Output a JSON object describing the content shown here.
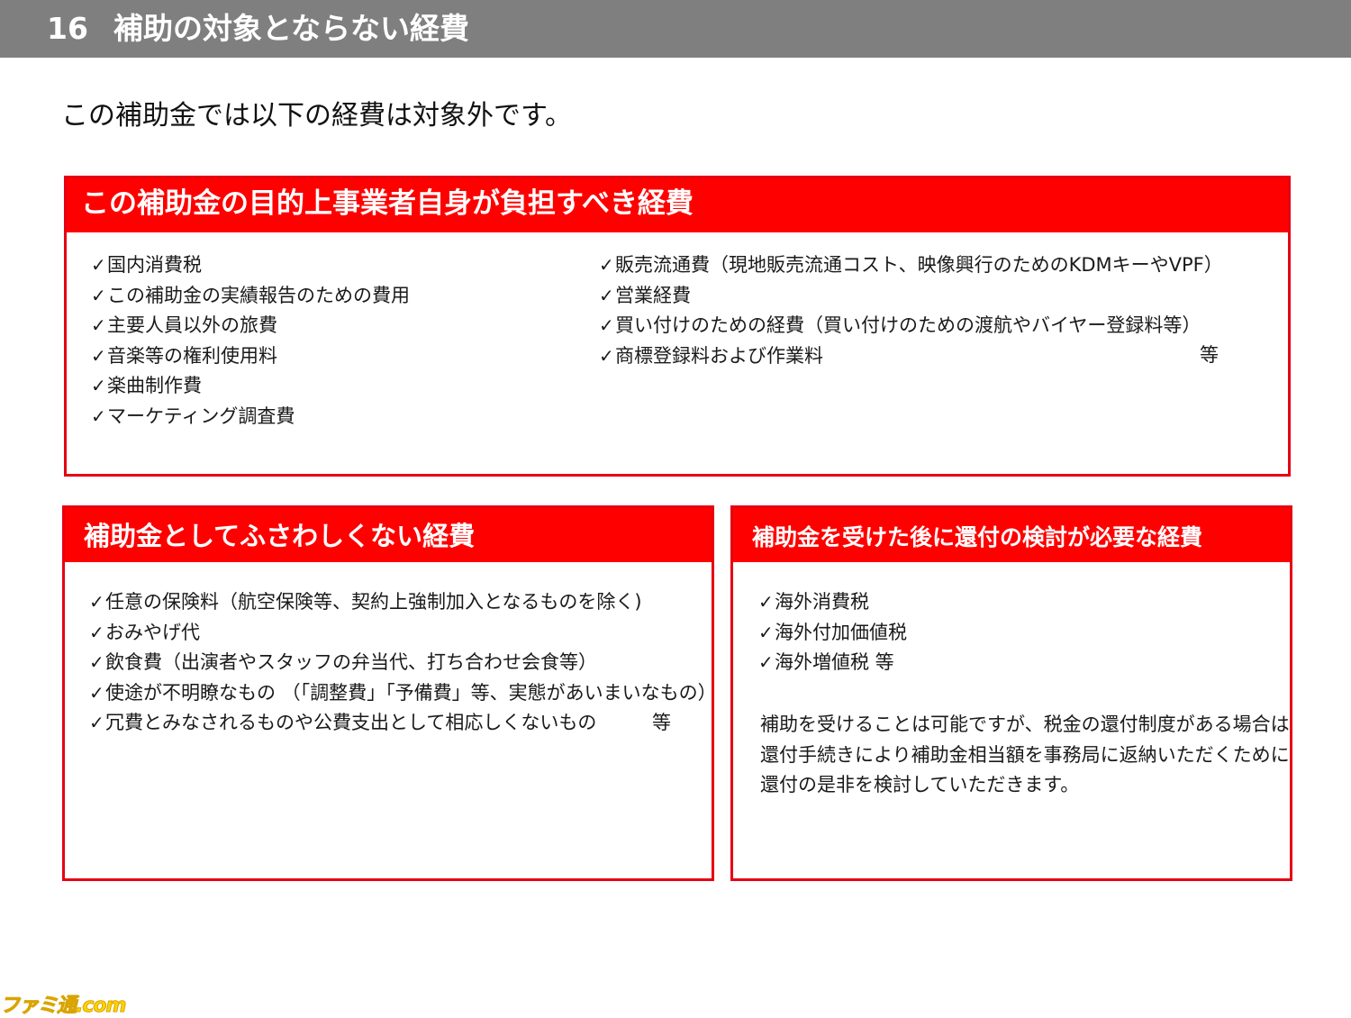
{
  "title": {
    "number": "16",
    "text": "補助の対象とならない経費"
  },
  "intro": "この補助金では以下の経費は対象外です。",
  "section1": {
    "header": "この補助金の目的上事業者自身が負担すべき経費",
    "left_items": [
      "国内消費税",
      "この補助金の実績報告のための費用",
      "主要人員以外の旅費",
      "音楽等の権利使用料",
      "楽曲制作費",
      "マーケティング調査費"
    ],
    "right_items": [
      "販売流通費（現地販売流通コスト、映像興行のためのKDMキーやVPF）",
      "営業経費",
      "買い付けのための経費（買い付けのための渡航やバイヤー登録料等）",
      "商標登録料および作業料"
    ],
    "etc": "等"
  },
  "section2": {
    "header": "補助金としてふさわしくない経費",
    "items": [
      "任意の保険料（航空保険等、契約上強制加入となるものを除く)",
      "おみやげ代",
      "飲食費（出演者やスタッフの弁当代、打ち合わせ会食等）",
      "使途が不明瞭なもの （「調整費」「予備費」等、実態があいまいなもの）",
      "冗費とみなされるものや公費支出として相応しくないもの"
    ],
    "etc": "等"
  },
  "section3": {
    "header": "補助金を受けた後に還付の検討が必要な経費",
    "items": [
      "海外消費税",
      "海外付加価値税",
      "海外増値税 等"
    ],
    "note_lines": [
      "補助を受けることは可能ですが、税金の還付制度がある場合は",
      "還付手続きにより補助金相当額を事務局に返納いただくために",
      "還付の是非を検討していただきます。"
    ]
  },
  "check_mark": "✓",
  "logo": "ファミ通.com"
}
